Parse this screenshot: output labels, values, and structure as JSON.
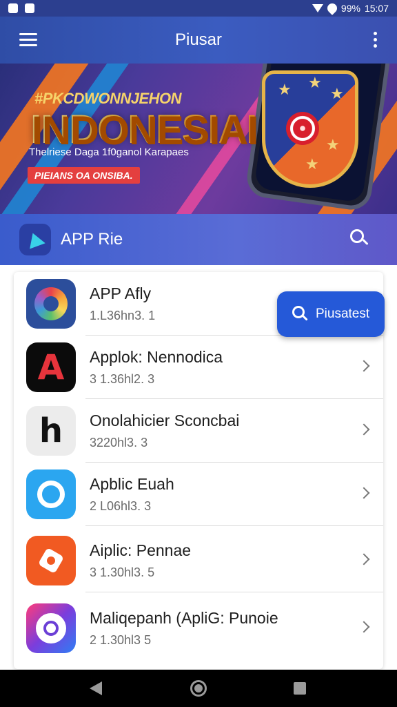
{
  "status_bar": {
    "battery": "99%",
    "time": "15:07"
  },
  "app_bar": {
    "title": "Piusar"
  },
  "banner": {
    "subheadline": "#PKCDWONNJEHON",
    "headline": "INDONESIAI",
    "tagline": "Thelriese Daga 1f0ganol Karapaes",
    "pill_text": "PIEIANS OA ONSIBA."
  },
  "section": {
    "title": "APP Rie"
  },
  "floating_search": {
    "label": "Piusatest"
  },
  "apps": [
    {
      "name": "APP Afly",
      "version": "1.L36hn3. 1",
      "icon": "rainbow-ring-icon"
    },
    {
      "name": "Applok: Nennodica",
      "version": "3 1.36hl2. 3",
      "icon": "letter-a-icon"
    },
    {
      "name": "Onolahicier Sconcbai",
      "version": "3220hl3. 3",
      "icon": "letter-h-icon"
    },
    {
      "name": "Apblic Euah",
      "version": "2 L06hl3. 3",
      "icon": "blue-gear-icon"
    },
    {
      "name": "Aiplic: Pennae",
      "version": "3 1.30hl3. 5",
      "icon": "orange-hex-icon"
    },
    {
      "name": "Maliqepanh (ApliG: Punoie",
      "version": "2 1.30hl3 5",
      "icon": "gradient-target-icon"
    }
  ]
}
